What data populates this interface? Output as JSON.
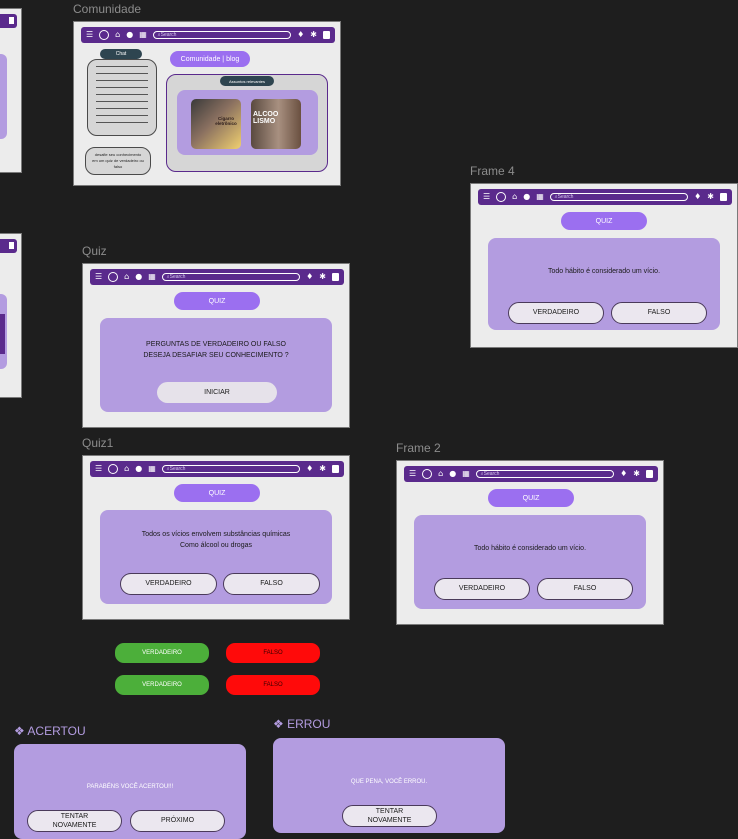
{
  "colors": {
    "canvas": "#1e1e1e",
    "nav": "#5a2a8c",
    "accent": "#9b6ff0",
    "card": "#b39ce0",
    "true_green": "#4caf3a",
    "false_red": "#ff0a0a"
  },
  "nav_icons": [
    "menu-icon",
    "logo-icon",
    "home-icon",
    "location-icon",
    "chart-icon",
    "search-icon",
    "bell-icon",
    "gear-icon",
    "exit-icon"
  ],
  "search_placeholder": "Search",
  "comunidade": {
    "label": "Comunidade",
    "chat_label": "Chat",
    "blog_button": "Comunidade | blog",
    "relevant_topics": "Assuntos relevantes",
    "challenge_text": "desafie seu conhecimento em um quiz de verdadeiro ou falso",
    "card1_text": "Cigarro eletrônico",
    "card2_text": "ALCOOLISMO"
  },
  "quiz": {
    "label": "Quiz",
    "pill": "QUIZ",
    "question": "PERGUNTAS DE VERDADEIRO OU FALSO\nDESEJA DESAFIAR SEU CONHECIMENTO ?",
    "start_button": "INICIAR"
  },
  "quiz1": {
    "label": "Quiz1",
    "pill": "QUIZ",
    "question": "Todos os vícios envolvem substâncias químicas\nComo álcool ou drogas",
    "true_button": "VERDADEIRO",
    "false_button": "FALSO"
  },
  "frame2": {
    "label": "Frame 2",
    "pill": "QUIZ",
    "question": "Todo hábito é considerado um vício.",
    "true_button": "VERDADEIRO",
    "false_button": "FALSO"
  },
  "frame4": {
    "label": "Frame 4",
    "pill": "QUIZ",
    "question": "Todo hábito é considerado um vício.",
    "true_button": "VERDADEIRO",
    "false_button": "FALSO"
  },
  "states": {
    "true_label": "VERDADEIRO",
    "false_label": "FALSO"
  },
  "acertou": {
    "label": "❖ ACERTOU",
    "message": "PARABÉNS VOCÊ ACERTOU!!!",
    "retry_button": "TENTAR NOVAMENTE",
    "next_button": "PRÓXIMO"
  },
  "errou": {
    "label": "❖ ERROU",
    "message": "QUE PENA, VOCÊ ERROU.",
    "retry_button": "TENTAR NOVAMENTE"
  }
}
